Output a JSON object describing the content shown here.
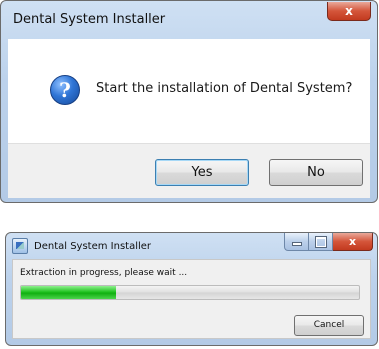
{
  "confirm_dialog": {
    "title": "Dental System Installer",
    "message": "Start the installation of Dental System?",
    "icon": "question-icon",
    "yes_label": "Yes",
    "no_label": "No",
    "close_glyph": "x"
  },
  "progress_dialog": {
    "title": "Dental System Installer",
    "status_text": "Extraction in progress, please wait ...",
    "progress_percent": 28,
    "cancel_label": "Cancel",
    "close_glyph": "x"
  },
  "colors": {
    "progress_green": "#22c322",
    "titlebar_blue": "#bcd2ec",
    "close_red": "#c23a1f"
  }
}
